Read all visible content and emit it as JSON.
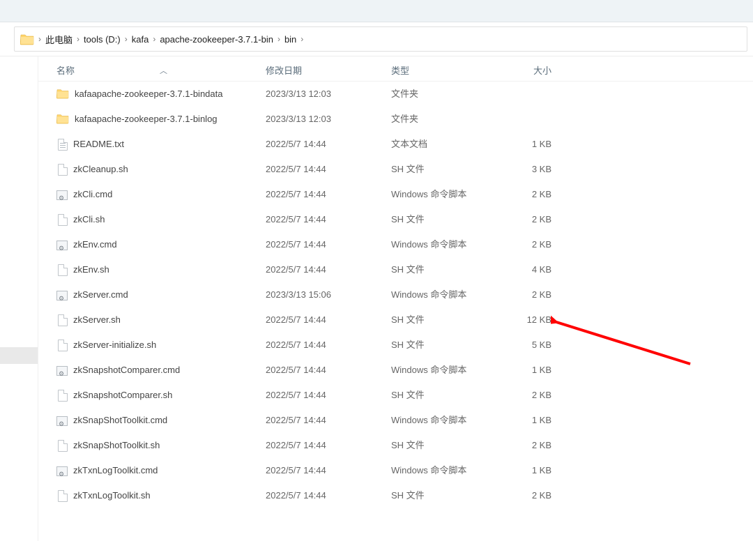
{
  "breadcrumb": {
    "items": [
      "此电脑",
      "tools (D:)",
      "kafa",
      "apache-zookeeper-3.7.1-bin",
      "bin"
    ]
  },
  "columns": {
    "name": "名称",
    "date": "修改日期",
    "type": "类型",
    "size": "大小"
  },
  "files": [
    {
      "icon": "folder",
      "name": "kafaapache-zookeeper-3.7.1-bindata",
      "date": "2023/3/13 12:03",
      "type": "文件夹",
      "size": ""
    },
    {
      "icon": "folder",
      "name": "kafaapache-zookeeper-3.7.1-binlog",
      "date": "2023/3/13 12:03",
      "type": "文件夹",
      "size": ""
    },
    {
      "icon": "txt",
      "name": "README.txt",
      "date": "2022/5/7 14:44",
      "type": "文本文档",
      "size": "1 KB"
    },
    {
      "icon": "file",
      "name": "zkCleanup.sh",
      "date": "2022/5/7 14:44",
      "type": "SH 文件",
      "size": "3 KB"
    },
    {
      "icon": "cmd",
      "name": "zkCli.cmd",
      "date": "2022/5/7 14:44",
      "type": "Windows 命令脚本",
      "size": "2 KB"
    },
    {
      "icon": "file",
      "name": "zkCli.sh",
      "date": "2022/5/7 14:44",
      "type": "SH 文件",
      "size": "2 KB"
    },
    {
      "icon": "cmd",
      "name": "zkEnv.cmd",
      "date": "2022/5/7 14:44",
      "type": "Windows 命令脚本",
      "size": "2 KB"
    },
    {
      "icon": "file",
      "name": "zkEnv.sh",
      "date": "2022/5/7 14:44",
      "type": "SH 文件",
      "size": "4 KB"
    },
    {
      "icon": "cmd",
      "name": "zkServer.cmd",
      "date": "2023/3/13 15:06",
      "type": "Windows 命令脚本",
      "size": "2 KB"
    },
    {
      "icon": "file",
      "name": "zkServer.sh",
      "date": "2022/5/7 14:44",
      "type": "SH 文件",
      "size": "12 KB"
    },
    {
      "icon": "file",
      "name": "zkServer-initialize.sh",
      "date": "2022/5/7 14:44",
      "type": "SH 文件",
      "size": "5 KB"
    },
    {
      "icon": "cmd",
      "name": "zkSnapshotComparer.cmd",
      "date": "2022/5/7 14:44",
      "type": "Windows 命令脚本",
      "size": "1 KB"
    },
    {
      "icon": "file",
      "name": "zkSnapshotComparer.sh",
      "date": "2022/5/7 14:44",
      "type": "SH 文件",
      "size": "2 KB"
    },
    {
      "icon": "cmd",
      "name": "zkSnapShotToolkit.cmd",
      "date": "2022/5/7 14:44",
      "type": "Windows 命令脚本",
      "size": "1 KB"
    },
    {
      "icon": "file",
      "name": "zkSnapShotToolkit.sh",
      "date": "2022/5/7 14:44",
      "type": "SH 文件",
      "size": "2 KB"
    },
    {
      "icon": "cmd",
      "name": "zkTxnLogToolkit.cmd",
      "date": "2022/5/7 14:44",
      "type": "Windows 命令脚本",
      "size": "1 KB"
    },
    {
      "icon": "file",
      "name": "zkTxnLogToolkit.sh",
      "date": "2022/5/7 14:44",
      "type": "SH 文件",
      "size": "2 KB"
    }
  ],
  "sidebar_cut_label": ")"
}
